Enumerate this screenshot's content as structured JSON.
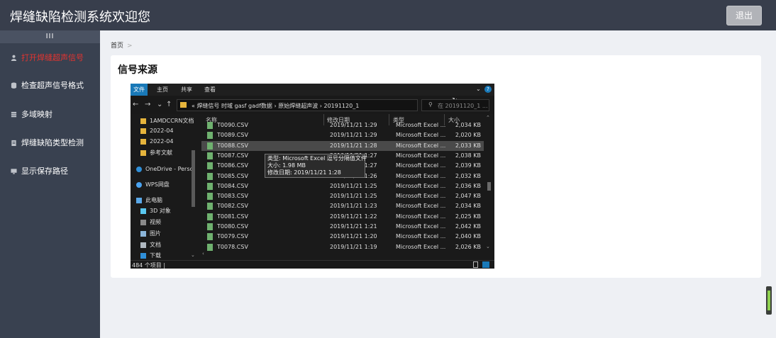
{
  "header": {
    "title": "焊缝缺陷检测系统欢迎您",
    "logout_label": "退出"
  },
  "sidebar": {
    "toggle_label": "III",
    "items": [
      {
        "label": "打开焊缝超声信号",
        "icon": "user-icon",
        "active": true
      },
      {
        "label": "检查超声信号格式",
        "icon": "database-icon",
        "active": false
      },
      {
        "label": "多域映射",
        "icon": "stack-icon",
        "active": false
      },
      {
        "label": "焊缝缺陷类型检测",
        "icon": "clipboard-icon",
        "active": false
      },
      {
        "label": "显示保存路径",
        "icon": "monitor-icon",
        "active": false
      }
    ]
  },
  "breadcrumb": {
    "home": "首页",
    "separator": ">"
  },
  "card": {
    "title": "信号来源"
  },
  "explorer": {
    "ribbon_tabs": [
      "文件",
      "主页",
      "共享",
      "查看"
    ],
    "nav_buttons": [
      "←",
      "→",
      "⌄",
      "↑"
    ],
    "address": "« 焊缝信号 时域 gasf gadf数据  ›  原始焊缝超声波  ›  20191120_1",
    "search_placeholder": "在 20191120_1 ...",
    "nav_items": [
      {
        "label": "1AMDCCRN文档",
        "icon": "folder-icon"
      },
      {
        "label": "2022-04",
        "icon": "folder-icon"
      },
      {
        "label": "2022-04",
        "icon": "folder-icon"
      },
      {
        "label": "参考文献",
        "icon": "folder-icon"
      },
      {
        "label": "OneDrive - Persc",
        "icon": "cloud-icon"
      },
      {
        "label": "WPS网盘",
        "icon": "cloud-icon"
      },
      {
        "label": "此电脑",
        "icon": "computer-icon"
      },
      {
        "label": "3D 对象",
        "icon": "cube-icon"
      },
      {
        "label": "视频",
        "icon": "video-icon"
      },
      {
        "label": "图片",
        "icon": "image-icon"
      },
      {
        "label": "文档",
        "icon": "document-icon"
      },
      {
        "label": "下载",
        "icon": "download-icon"
      }
    ],
    "columns": {
      "name": "名称",
      "date": "修改日期",
      "type": "类型",
      "size": "大小"
    },
    "files": [
      {
        "name": "T0090.CSV",
        "date": "2019/11/21 1:29",
        "type": "Microsoft Excel ...",
        "size": "2,034 KB",
        "selected": false
      },
      {
        "name": "T0089.CSV",
        "date": "2019/11/21 1:29",
        "type": "Microsoft Excel ...",
        "size": "2,020 KB",
        "selected": false
      },
      {
        "name": "T0088.CSV",
        "date": "2019/11/21 1:28",
        "type": "Microsoft Excel ...",
        "size": "2,033 KB",
        "selected": true
      },
      {
        "name": "T0087.CSV",
        "date": "2019/11/21 1:27",
        "type": "Microsoft Excel ...",
        "size": "2,038 KB",
        "selected": false
      },
      {
        "name": "T0086.CSV",
        "date": "2019/11/21 1:27",
        "type": "Microsoft Excel ...",
        "size": "2,039 KB",
        "selected": false
      },
      {
        "name": "T0085.CSV",
        "date": "2019/11/21 1:26",
        "type": "Microsoft Excel ...",
        "size": "2,032 KB",
        "selected": false
      },
      {
        "name": "T0084.CSV",
        "date": "2019/11/21 1:25",
        "type": "Microsoft Excel ...",
        "size": "2,036 KB",
        "selected": false
      },
      {
        "name": "T0083.CSV",
        "date": "2019/11/21 1:25",
        "type": "Microsoft Excel ...",
        "size": "2,047 KB",
        "selected": false
      },
      {
        "name": "T0082.CSV",
        "date": "2019/11/21 1:23",
        "type": "Microsoft Excel ...",
        "size": "2,034 KB",
        "selected": false
      },
      {
        "name": "T0081.CSV",
        "date": "2019/11/21 1:22",
        "type": "Microsoft Excel ...",
        "size": "2,025 KB",
        "selected": false
      },
      {
        "name": "T0080.CSV",
        "date": "2019/11/21 1:21",
        "type": "Microsoft Excel ...",
        "size": "2,042 KB",
        "selected": false
      },
      {
        "name": "T0079.CSV",
        "date": "2019/11/21 1:20",
        "type": "Microsoft Excel ...",
        "size": "2,040 KB",
        "selected": false
      },
      {
        "name": "T0078.CSV",
        "date": "2019/11/21 1:19",
        "type": "Microsoft Excel ...",
        "size": "2,026 KB",
        "selected": false
      }
    ],
    "tooltip": {
      "type_line": "类型: Microsoft Excel 逗号分隔值文件",
      "size_line": "大小: 1.98 MB",
      "date_line": "修改日期: 2019/11/21 1:28"
    },
    "status": "484 个项目  |"
  },
  "colors": {
    "topbar": "#383e4c",
    "sidebar": "#394150",
    "active_menu": "#e3342f",
    "page_bg": "#eef0f4",
    "explorer_bg": "#1a1a1a",
    "file_tab": "#1979b8"
  }
}
